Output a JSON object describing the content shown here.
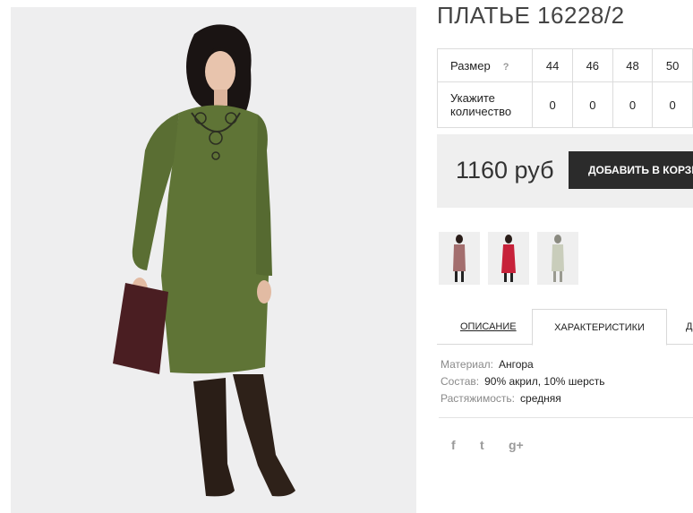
{
  "product": {
    "title": "ПЛАТЬЕ 16228/2"
  },
  "size_table": {
    "size_label": "Размер",
    "help": "?",
    "sizes": [
      "44",
      "46",
      "48",
      "50"
    ],
    "qty_label_line1": "Укажите",
    "qty_label_line2": "количество",
    "quantities": [
      "0",
      "0",
      "0",
      "0"
    ]
  },
  "purchase": {
    "price": "1160 руб",
    "add_button_label": "ДОБАВИТЬ В КОРЗИНУ"
  },
  "colors": {
    "dress_main": "#5f7436",
    "thumbnail_dresses": [
      "#a36e6e",
      "#c7223a",
      "#c9cdbb"
    ]
  },
  "tabs": {
    "description": "ОПИСАНИЕ",
    "characteristics": "ХАРАКТЕРИСТИКИ",
    "third": "Д"
  },
  "specs": {
    "material_label": "Материал:",
    "material_value": "Ангора",
    "composition_label": "Состав:",
    "composition_value": "90% акрил, 10% шерсть",
    "stretch_label": "Растяжимость:",
    "stretch_value": "средняя"
  },
  "social": {
    "facebook": "f",
    "twitter": "t",
    "googleplus": "g+"
  }
}
